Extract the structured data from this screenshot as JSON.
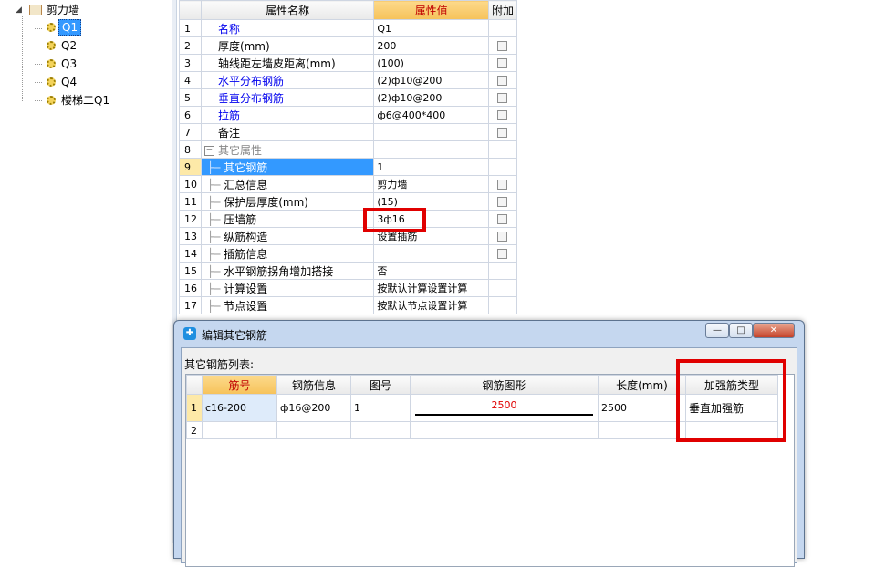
{
  "tree": {
    "root": "剪力墙",
    "items": [
      "Q1",
      "Q2",
      "Q3",
      "Q4",
      "楼梯二Q1"
    ],
    "selected_index": 0
  },
  "properties": {
    "headers": {
      "name": "属性名称",
      "value": "属性值",
      "extra": "附加"
    },
    "rows": [
      {
        "num": "1",
        "name": "名称",
        "value": "Q1",
        "blue": true,
        "check": false
      },
      {
        "num": "2",
        "name": "厚度(mm)",
        "value": "200",
        "blue": false,
        "check": true
      },
      {
        "num": "3",
        "name": "轴线距左墙皮距离(mm)",
        "value": "(100)",
        "blue": false,
        "check": true
      },
      {
        "num": "4",
        "name": "水平分布钢筋",
        "value": "(2)ф10@200",
        "blue": true,
        "check": true
      },
      {
        "num": "5",
        "name": "垂直分布钢筋",
        "value": "(2)ф10@200",
        "blue": true,
        "check": true
      },
      {
        "num": "6",
        "name": "拉筋",
        "value": "ф6@400*400",
        "blue": true,
        "check": true
      },
      {
        "num": "7",
        "name": "备注",
        "value": "",
        "blue": false,
        "check": true
      },
      {
        "num": "8",
        "name": "其它属性",
        "value": "",
        "group": true
      },
      {
        "num": "9",
        "name": "其它钢筋",
        "value": "1",
        "sub": true,
        "selected": true
      },
      {
        "num": "10",
        "name": "汇总信息",
        "value": "剪力墙",
        "sub": true,
        "check": true
      },
      {
        "num": "11",
        "name": "保护层厚度(mm)",
        "value": "(15)",
        "sub": true,
        "check": true
      },
      {
        "num": "12",
        "name": "压墙筋",
        "value": "3ф16",
        "sub": true,
        "check": true
      },
      {
        "num": "13",
        "name": "纵筋构造",
        "value": "设置插筋",
        "sub": true,
        "check": true
      },
      {
        "num": "14",
        "name": "插筋信息",
        "value": "",
        "sub": true,
        "check": true
      },
      {
        "num": "15",
        "name": "水平钢筋拐角增加搭接",
        "value": "否",
        "sub": true
      },
      {
        "num": "16",
        "name": "计算设置",
        "value": "按默认计算设置计算",
        "sub": true
      },
      {
        "num": "17",
        "name": "节点设置",
        "value": "按默认节点设置计算",
        "sub": true
      }
    ]
  },
  "dialog": {
    "title": "编辑其它钢筋",
    "list_label": "其它钢筋列表:",
    "buttons": {
      "min": "—",
      "max": "□",
      "close": "✕"
    },
    "columns": [
      "筋号",
      "钢筋信息",
      "图号",
      "钢筋图形",
      "长度(mm)",
      "加强筋类型"
    ],
    "rows": [
      {
        "rn": "1",
        "code": "c16-200",
        "info": "ф16@200",
        "fig": "1",
        "shape_len": "2500",
        "length": "2500",
        "type": "垂直加强筋"
      },
      {
        "rn": "2",
        "code": "",
        "info": "",
        "fig": "",
        "shape_len": "",
        "length": "",
        "type": ""
      }
    ]
  },
  "colors": {
    "highlight_red": "#e00000",
    "selection_blue": "#3399ff",
    "header_orange": "#f6c25a"
  }
}
